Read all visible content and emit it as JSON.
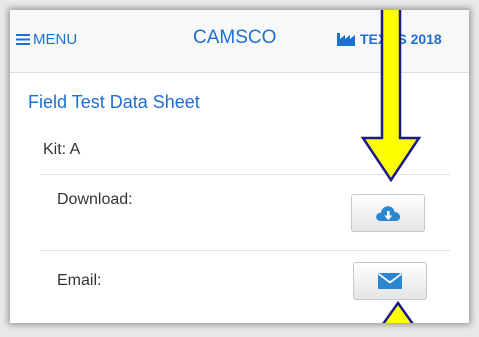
{
  "header": {
    "menu_label": "MENU",
    "brand": "CAMSCO",
    "event_label": "TEXAS 2018"
  },
  "main": {
    "title": "Field Test Data Sheet",
    "kit_label": "Kit: A",
    "rows": [
      {
        "label": "Download:",
        "button_icon": "cloud-download-icon"
      },
      {
        "label": "Email:",
        "button_icon": "envelope-icon"
      }
    ]
  },
  "colors": {
    "accent": "#1d6fd0",
    "arrow_fill": "#ffff00",
    "arrow_stroke": "#1a1a8c",
    "icon": "#2a86d1"
  }
}
